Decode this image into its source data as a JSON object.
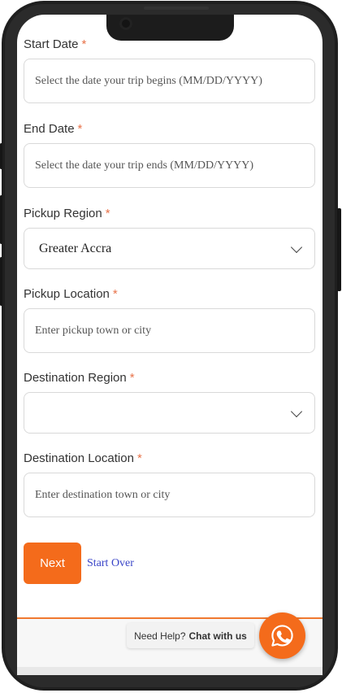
{
  "form": {
    "start_date": {
      "label": "Start Date",
      "required": "*",
      "placeholder": "Select the date your trip begins (MM/DD/YYYY)"
    },
    "end_date": {
      "label": "End Date",
      "required": "*",
      "placeholder": "Select the date your trip ends (MM/DD/YYYY)"
    },
    "pickup_region": {
      "label": "Pickup Region",
      "required": "*",
      "value": "Greater Accra"
    },
    "pickup_location": {
      "label": "Pickup Location",
      "required": "*",
      "placeholder": "Enter pickup town or city"
    },
    "destination_region": {
      "label": "Destination Region",
      "required": "*",
      "value": ""
    },
    "destination_location": {
      "label": "Destination Location",
      "required": "*",
      "placeholder": "Enter destination town or city"
    }
  },
  "actions": {
    "next_label": "Next",
    "start_over_label": "Start Over"
  },
  "help": {
    "prefix": "Need Help?",
    "link": "Chat with us",
    "icon": "whatsapp-icon"
  },
  "colors": {
    "accent": "#f46b1b",
    "required": "#e8734a",
    "link": "#3a45c8"
  }
}
